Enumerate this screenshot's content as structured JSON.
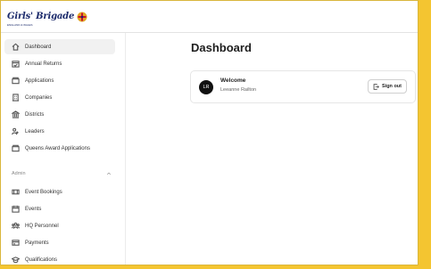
{
  "brand": {
    "logo_text": "Girls' Brigade",
    "logo_sub": "ENGLAND & WALES"
  },
  "sidebar": {
    "items": [
      {
        "label": "Dashboard",
        "icon": "home-icon"
      },
      {
        "label": "Annual Returns",
        "icon": "calendar-check-icon"
      },
      {
        "label": "Applications",
        "icon": "folder-icon"
      },
      {
        "label": "Companies",
        "icon": "building-icon"
      },
      {
        "label": "Districts",
        "icon": "bank-icon"
      },
      {
        "label": "Leaders",
        "icon": "users-icon"
      },
      {
        "label": "Queens Award Applications",
        "icon": "folder-icon"
      }
    ],
    "admin_label": "Admin",
    "admin_items": [
      {
        "label": "Event Bookings",
        "icon": "ticket-icon"
      },
      {
        "label": "Events",
        "icon": "calendar-icon"
      },
      {
        "label": "HQ Personnel",
        "icon": "team-icon"
      },
      {
        "label": "Payments",
        "icon": "credit-card-icon"
      },
      {
        "label": "Qualifications",
        "icon": "graduation-cap-icon"
      }
    ]
  },
  "main": {
    "title": "Dashboard",
    "welcome_card": {
      "avatar_initials": "LR",
      "heading": "Welcome",
      "user_name": "Leeanne Railton",
      "signout_label": "Sign out"
    }
  },
  "colors": {
    "frame_border": "#f4c531",
    "active_bg": "#f1f1f1",
    "avatar_bg": "#111111"
  }
}
